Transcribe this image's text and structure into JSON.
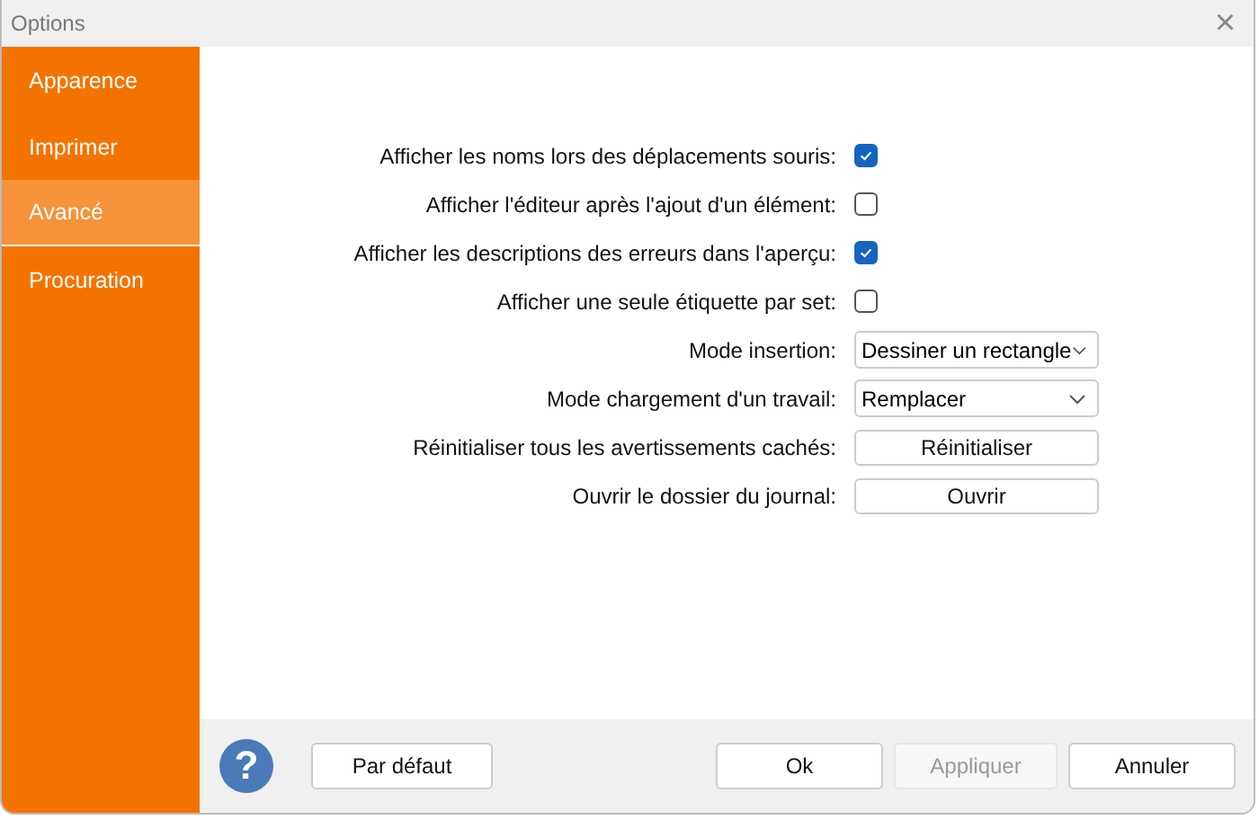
{
  "window": {
    "title": "Options",
    "close": "×"
  },
  "sidebar": {
    "items": [
      {
        "label": "Apparence",
        "selected": false
      },
      {
        "label": "Imprimer",
        "selected": false
      },
      {
        "label": "Avancé",
        "selected": true
      },
      {
        "label": "Procuration",
        "selected": false
      }
    ]
  },
  "settings": [
    {
      "kind": "checkbox",
      "label": "Afficher les noms lors des déplacements souris:",
      "checked": true
    },
    {
      "kind": "checkbox",
      "label": "Afficher l'éditeur après l'ajout d'un élément:",
      "checked": false
    },
    {
      "kind": "checkbox",
      "label": "Afficher les descriptions des erreurs dans l'aperçu:",
      "checked": true
    },
    {
      "kind": "checkbox",
      "label": "Afficher une seule étiquette par set:",
      "checked": false
    },
    {
      "kind": "dropdown",
      "label": "Mode insertion:",
      "value": "Dessiner un rectangle"
    },
    {
      "kind": "dropdown",
      "label": "Mode chargement d'un travail:",
      "value": "Remplacer"
    },
    {
      "kind": "button",
      "label": "Réinitialiser tous les avertissements cachés:",
      "button": "Réinitialiser"
    },
    {
      "kind": "button",
      "label": "Ouvrir le dossier du journal:",
      "button": "Ouvrir"
    }
  ],
  "footer": {
    "help": "?",
    "buttons": [
      {
        "label": "Par défaut",
        "disabled": false
      },
      {
        "label": "Ok",
        "disabled": false
      },
      {
        "label": "Appliquer",
        "disabled": true
      },
      {
        "label": "Annuler",
        "disabled": false
      }
    ]
  }
}
